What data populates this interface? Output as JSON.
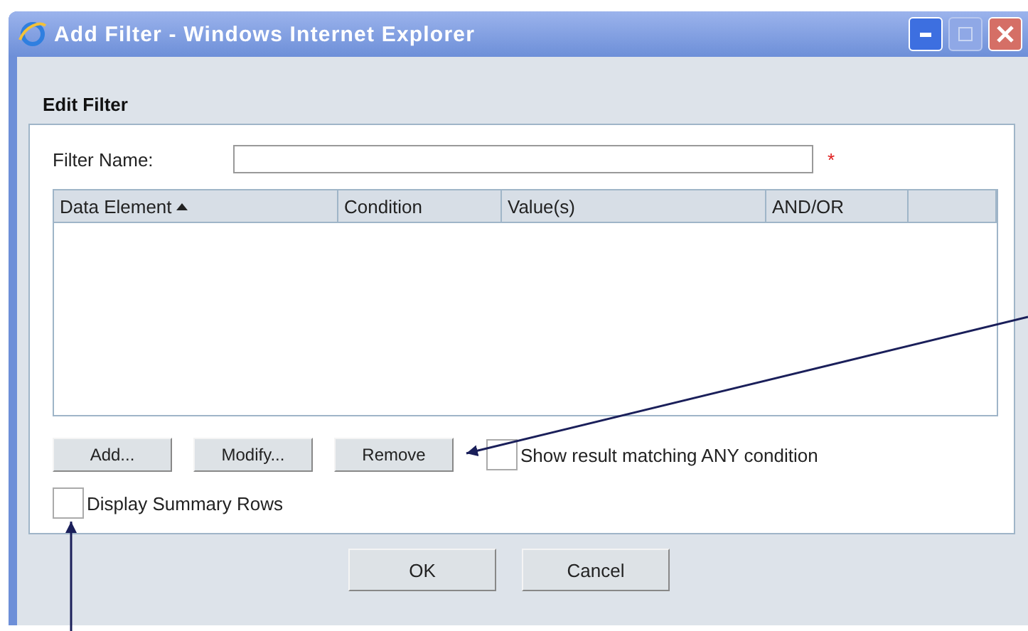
{
  "window": {
    "title": "Add Filter - Windows Internet Explorer"
  },
  "section_title": "Edit Filter",
  "filter_name": {
    "label": "Filter Name:",
    "required_mark": "*"
  },
  "table": {
    "columns": [
      {
        "label": "Data Element",
        "sorted": true
      },
      {
        "label": "Condition",
        "sorted": false
      },
      {
        "label": "Value(s)",
        "sorted": false
      },
      {
        "label": "AND/OR",
        "sorted": false
      },
      {
        "sorted": false
      }
    ]
  },
  "row_buttons": [
    "Add...",
    "Modify...",
    "Remove"
  ],
  "match_any": {
    "label": "Show result matching ANY condition",
    "checked": false
  },
  "summary_rows": {
    "label": "Display Summary Rows",
    "checked": false
  },
  "dialog_buttons": [
    "OK",
    "Cancel"
  ]
}
